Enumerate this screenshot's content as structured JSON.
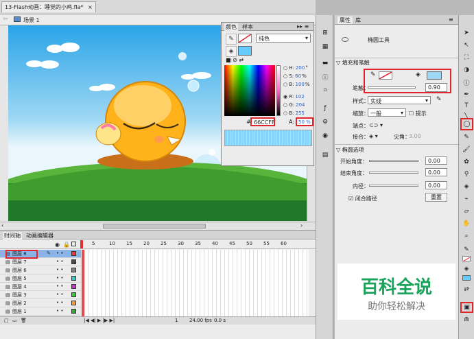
{
  "document": {
    "tab_title": "13-Flash动画：睡觉的小鸡.fla*",
    "close_glyph": "×",
    "scene_label": "场景 1"
  },
  "color_panel": {
    "tab_color": "颜色",
    "tab_swatches": "样本",
    "fill_type": "纯色",
    "hsb": [
      {
        "key": "H:",
        "value": "200",
        "unit": "°"
      },
      {
        "key": "S:",
        "value": "60",
        "unit": "%"
      },
      {
        "key": "B:",
        "value": "100",
        "unit": "%"
      }
    ],
    "rgb": [
      {
        "key": "R:",
        "value": "102"
      },
      {
        "key": "G:",
        "value": "204"
      },
      {
        "key": "B:",
        "value": "255"
      }
    ],
    "hex": "66CCFF",
    "alpha_label": "A:",
    "alpha_value": "50 %",
    "fill_color": "#66ccff"
  },
  "properties": {
    "tab_props": "属性",
    "tab_library": "库",
    "tool_name": "椭圆工具",
    "section_fill_stroke": "填充和笔触",
    "stroke_label": "笔触：",
    "stroke_value": "0.90",
    "style_label": "样式：",
    "style_value": "实线",
    "scale_label": "缩放：",
    "scale_value": "一般",
    "hint_label": "提示",
    "cap_label": "端点：",
    "join_label": "接合：",
    "miter_label": "尖角：",
    "miter_value": "3.00",
    "section_ellipse": "椭圆选项",
    "start_angle_label": "开始角度：",
    "start_angle_value": "0.00",
    "end_angle_label": "结束角度：",
    "end_angle_value": "0.00",
    "inner_radius_label": "内径：",
    "inner_radius_value": "0.00",
    "close_path_label": "闭合路径",
    "reset_button": "重置"
  },
  "timeline": {
    "tab_timeline": "时间轴",
    "tab_motion": "动画编辑器",
    "frame_numbers": [
      "5",
      "10",
      "15",
      "20",
      "25",
      "30",
      "35",
      "40",
      "45",
      "50",
      "55",
      "60"
    ],
    "layers": [
      {
        "name": "图层 8",
        "color": "#ff3333"
      },
      {
        "name": "图层 7",
        "color": "#4a4a4a"
      },
      {
        "name": "图层 6",
        "color": "#808080"
      },
      {
        "name": "图层 5",
        "color": "#33cccc"
      },
      {
        "name": "图层 4",
        "color": "#cc33cc"
      },
      {
        "name": "图层 3",
        "color": "#33cc33"
      },
      {
        "name": "图层 2",
        "color": "#ff9933"
      },
      {
        "name": "图层 1",
        "color": "#33aa33"
      }
    ],
    "status_frame": "1",
    "status_fps": "24.00 fps",
    "status_time": "0.0 s"
  },
  "watermark": {
    "title": "百科全说",
    "subtitle": "助你轻松解决"
  }
}
